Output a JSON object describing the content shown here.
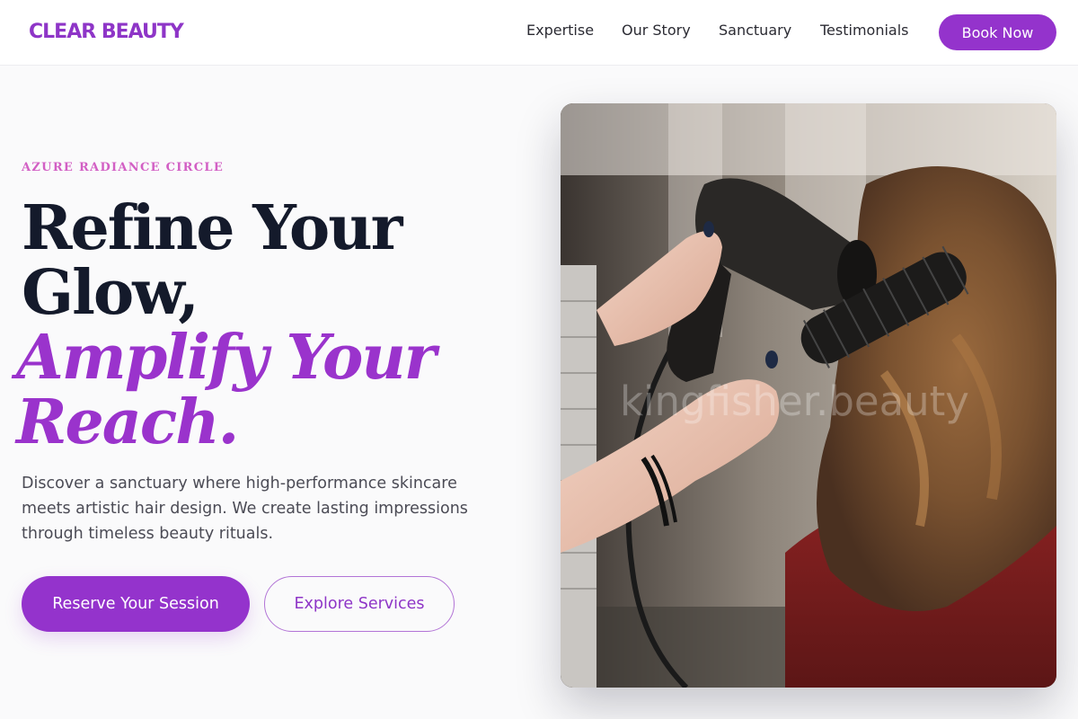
{
  "header": {
    "logo": "CLEAR BEAUTY",
    "nav": {
      "expertise": "Expertise",
      "our_story": "Our Story",
      "sanctuary": "Sanctuary",
      "testimonials": "Testimonials"
    },
    "book_now": "Book Now"
  },
  "hero": {
    "eyebrow": "AZURE RADIANCE CIRCLE",
    "headline_line1": "Refine Your",
    "headline_line2": "Glow,",
    "headline_accent_line1": "Amplify Your",
    "headline_accent_line2": "Reach.",
    "description": "Discover a sanctuary where high-performance skincare meets artistic hair design. We create lasting impressions through timeless beauty rituals.",
    "primary_cta": "Reserve Your Session",
    "secondary_cta": "Explore Services",
    "photo_watermark": "kingfisher.beauty"
  },
  "colors": {
    "brand_purple": "#9433cc",
    "eyebrow_pink": "#d25fc4",
    "headline_dark": "#141a2b",
    "body_text": "#4b4b55"
  }
}
